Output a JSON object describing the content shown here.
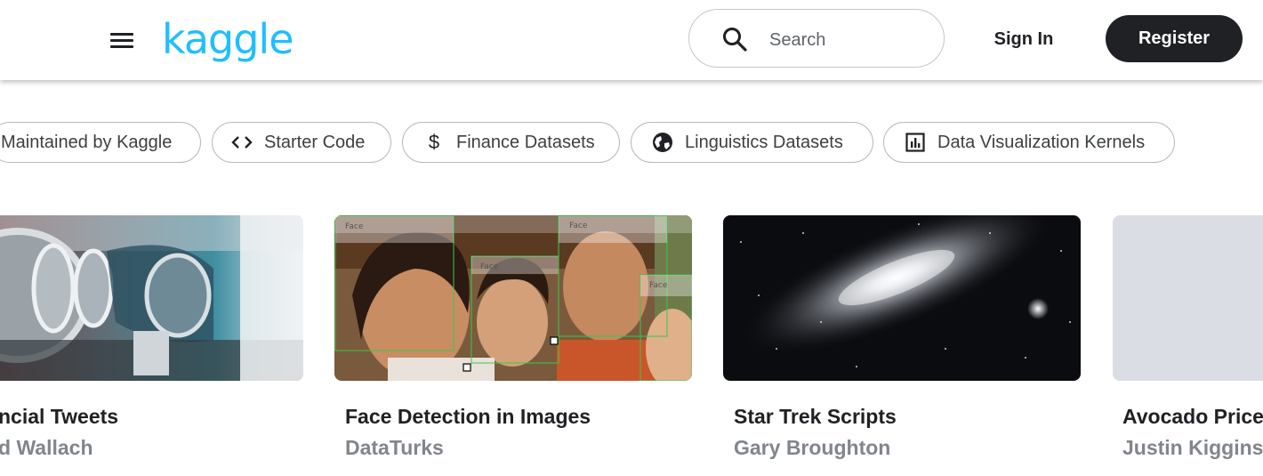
{
  "header": {
    "logo": "kaggle",
    "search_placeholder": "Search",
    "sign_in_label": "Sign In",
    "register_label": "Register"
  },
  "chips": [
    {
      "label": "Maintained by Kaggle",
      "icon": "none"
    },
    {
      "label": "Starter Code",
      "icon": "code-icon"
    },
    {
      "label": "Finance Datasets",
      "icon": "dollar-icon"
    },
    {
      "label": "Linguistics Datasets",
      "icon": "globe-icon"
    },
    {
      "label": "Data Visualization Kernels",
      "icon": "bar-chart-icon"
    }
  ],
  "cards": [
    {
      "title": "ncial Tweets",
      "owner": "d Wallach"
    },
    {
      "title": "Face Detection in Images",
      "owner": "DataTurks",
      "annotations": [
        "Face",
        "Face",
        "Face",
        "Face"
      ]
    },
    {
      "title": "Star Trek Scripts",
      "owner": "Gary Broughton"
    },
    {
      "title": "Avocado Price",
      "owner": "Justin Kiggins"
    }
  ],
  "colors": {
    "brand": "#20beff",
    "dark": "#202124",
    "muted": "#80868b"
  }
}
